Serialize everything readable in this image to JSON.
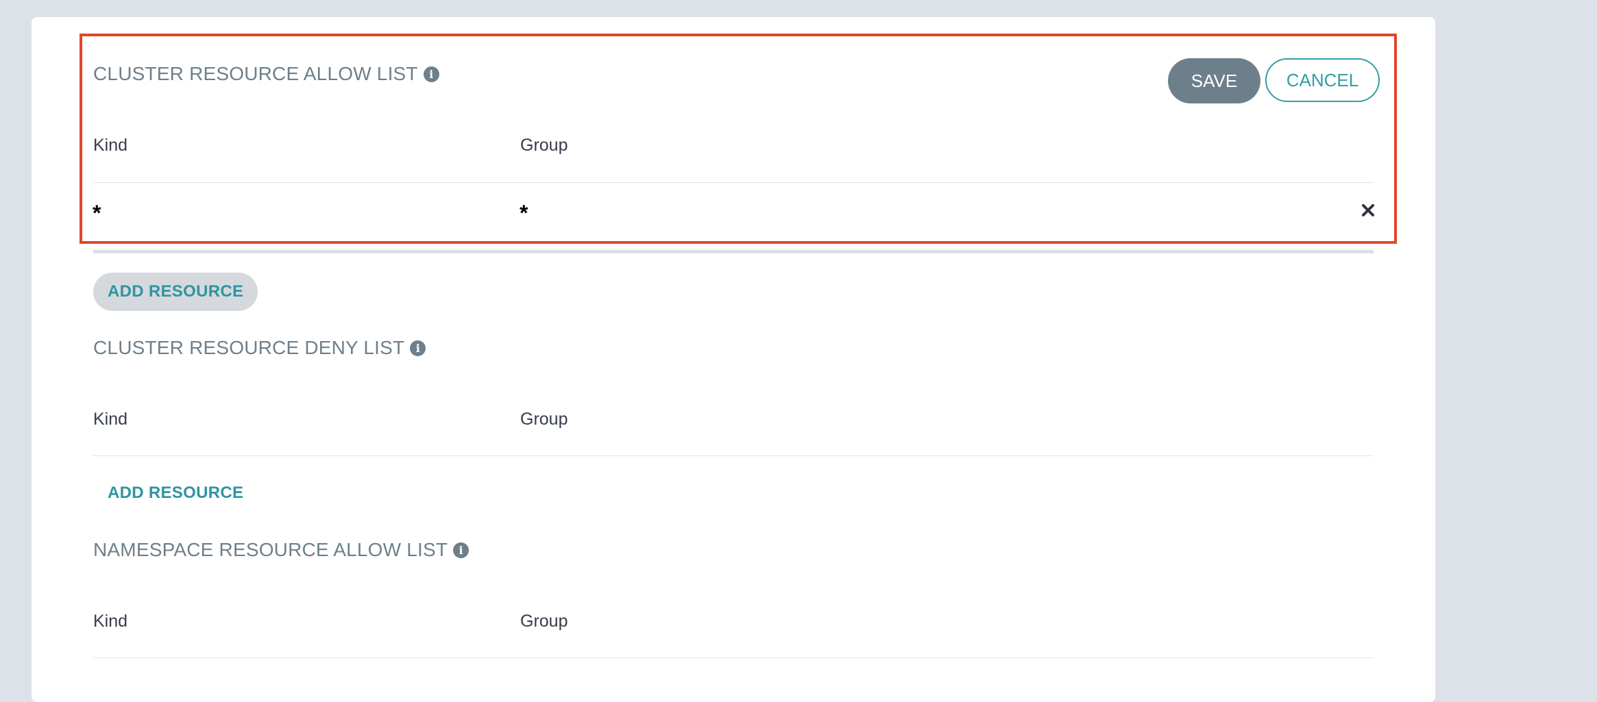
{
  "allow_list": {
    "title": "CLUSTER RESOURCE ALLOW LIST",
    "col_kind": "Kind",
    "col_group": "Group",
    "rows": [
      {
        "kind": "*",
        "group": "*"
      }
    ],
    "save_label": "SAVE",
    "cancel_label": "CANCEL",
    "add_label": "ADD RESOURCE"
  },
  "deny_list": {
    "title": "CLUSTER RESOURCE DENY LIST",
    "col_kind": "Kind",
    "col_group": "Group",
    "add_label": "ADD RESOURCE"
  },
  "namespace_allow_list": {
    "title": "NAMESPACE RESOURCE ALLOW LIST",
    "col_kind": "Kind",
    "col_group": "Group"
  },
  "colors": {
    "highlight": "#e2452b",
    "accent": "#2f9fa5",
    "primary_button": "#6d7f8b"
  },
  "icons": {
    "info": "info-icon",
    "remove": "close-icon"
  }
}
